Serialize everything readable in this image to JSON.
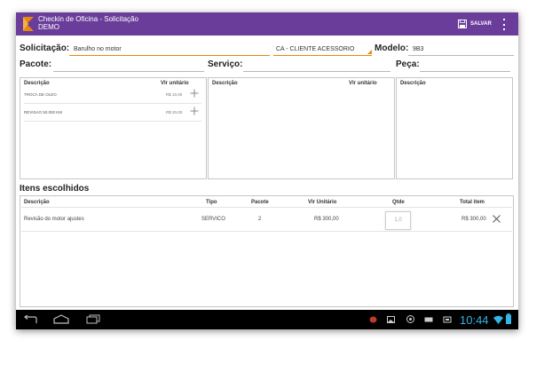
{
  "app": {
    "title": "Checkin de Oficina - Solicitação",
    "subtitle": "DEMO",
    "save_label": "SALVAR",
    "accent_color": "#6a3d9a",
    "highlight_color": "#e8890c"
  },
  "form": {
    "solicitacao_label": "Solicitação:",
    "solicitacao_value": "Barulho no motor",
    "cliente_value": "CA - CLIENTE ACESSORIO",
    "modelo_label": "Modelo:",
    "modelo_value": "9B3",
    "pacote_label": "Pacote:",
    "servico_label": "Serviço:",
    "peca_label": "Peça:"
  },
  "pacote_panel": {
    "col_descricao": "Descrição",
    "col_valor": "Vlr unitário",
    "items": [
      {
        "name": "TROCA DE OLEO",
        "price": "R$ 10,00",
        "icon": "plus-icon"
      },
      {
        "name": "REVISAO 50.000 KM",
        "price": "R$ 20,00",
        "icon": "plus-icon"
      }
    ]
  },
  "servico_panel": {
    "col_descricao": "Descrição",
    "col_valor": "Vlr unitário"
  },
  "peca_panel": {
    "col_descricao": "Descrição"
  },
  "itens": {
    "title": "Itens escolhidos",
    "headers": {
      "descricao": "Descrição",
      "tipo": "Tipo",
      "pacote": "Pacote",
      "vlr_unitario": "Vlr Unitário",
      "qtde": "Qtde",
      "total": "Total item"
    },
    "rows": [
      {
        "descricao": "Revisão do motor ajustes",
        "tipo": "SERVICO",
        "pacote": "2",
        "vlr_unitario": "R$ 300,00",
        "qtde": "1,0",
        "total": "R$ 300,00"
      }
    ]
  },
  "navbar": {
    "time": "10:44",
    "icons": [
      "back-icon",
      "home-icon",
      "recent-apps-icon",
      "status-app-icon",
      "image-icon",
      "android-icon",
      "usb-icon",
      "usb-debug-icon",
      "wifi-icon",
      "battery-icon"
    ]
  }
}
